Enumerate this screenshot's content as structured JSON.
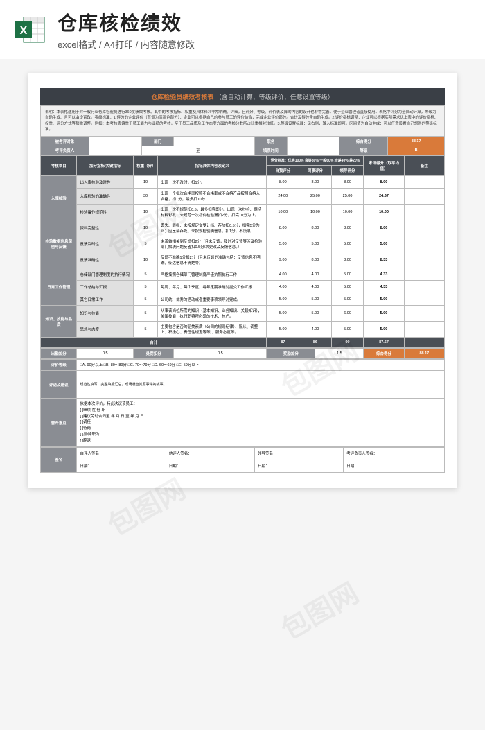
{
  "header": {
    "main_title": "仓库核检绩效",
    "sub_title": "excel格式 / A4打印 / 内容随意修改",
    "icon_label": "X"
  },
  "doc": {
    "title_main": "仓库检验员绩效考核表",
    "title_sub": "（含自动计算、等级评价、任意设置等级）",
    "instructions": "说明：本表格适用于对一般行业仓库检验员进行360度绩效考核。其中的考核指标、权重及具体释义非常明确、详细。且评分、等级、评价表及算的内容的设计也非常完善。便于企业管理者直接使用。表格中评分为全自动计算，等级为自动生成、且可以由设置改。零级标准：1.评分的企业评价（背景为深灰色部分）：企业可以根据自己的参与员工的评价结合，完成企业评价部分。合计及得分全自动生成。2.评价指标调整：企业可以根据实际需求优上表中的评价指标、权重、评分方式等稍微调整。例如：本考核表偏重于员工能力与业绩的考核，至于员工品质及工作态度方面的考核分数所占比重相对较低。3.等级设置标准：见右侧，输入标准即可。区间值为自动生成；可以任意设置自己想得的等级标准。"
  },
  "info": {
    "subject_label": "被考评对象",
    "dept_label": "部门",
    "position_label": "职务",
    "total_score_label": "综合得分",
    "total_score": "88.17",
    "leader_label": "考评负责人",
    "to_label": "至",
    "period_label": "填表时间",
    "grade_label": "等级",
    "grade": "B"
  },
  "table_head": {
    "c1": "考核项目",
    "c2": "加分指标/关键指标",
    "c3": "权重（分）",
    "c4": "指标具体内容及定义",
    "c5a": "评分标准：优秀100%   良好80%   一般60%    较差40%   差20%",
    "c5b1": "自我评分",
    "c5b2": "同事评分",
    "c5b3": "领导评分",
    "c6": "考评得分（取平均值）",
    "c7": "备注"
  },
  "chart_data": {
    "type": "table",
    "title": "仓库检验员绩效考核表",
    "sections": [
      {
        "name": "入库核验",
        "rows": [
          {
            "indicator": "出入库检验及时性",
            "weight": 10,
            "desc": "出现一次不及时，扣1分。",
            "self": 8.0,
            "peer": 8.0,
            "lead": 8.0,
            "score": 8.0
          },
          {
            "indicator": "入库检验的准确性",
            "weight": 30,
            "desc": "出现一个批次合格率按照不合格率或不合格产品按照合格入合格，扣1分，最多扣10分",
            "self": 24.0,
            "peer": 25.0,
            "lead": 25.0,
            "score": 24.67
          },
          {
            "indicator": "检验操作规范性",
            "weight": 10,
            "desc": "出现一次不规范扣0.5，最多扣完即分。出现一次抄检、保持材料彩孔、未规范一次初价检验漏扣2分，扣完10分为止。",
            "self": 10.0,
            "peer": 10.0,
            "lead": 10.0,
            "score": 10.0
          }
        ]
      },
      {
        "name": "检验数据信息保密与反馈",
        "rows": [
          {
            "indicator": "资料完整性",
            "weight": 10,
            "desc": "丢失、毁损、未按规定交受计档、存放扣0.5分，扣完5分为止；应呈会存处、未按规检验确信息，扣1分，不设限",
            "self": 8.0,
            "peer": 8.0,
            "lead": 8.0,
            "score": 8.0
          },
          {
            "indicator": "反馈及时性",
            "weight": 5,
            "desc": "未该做相关到反馈扣2分（且未反馈，及时对反馈等涉及检验部门解决问题反省扣0.5分/次更改及反馈信息。）",
            "self": 5.0,
            "peer": 5.0,
            "lead": 5.0,
            "score": 5.0
          },
          {
            "indicator": "反馈准确性",
            "weight": 10,
            "desc": "反馈不准确1分扣2分（且未反馈的准确包括：反馈信息不明确，传达信息不清楚等）",
            "self": 9.0,
            "peer": 8.0,
            "lead": 8.0,
            "score": 8.33
          }
        ]
      },
      {
        "name": "日常工作管理",
        "rows": [
          {
            "indicator": "仓储部门管理制度的执行情况",
            "weight": 5,
            "desc": "严格按照仓储部门管理制度严谨执照执行工作",
            "self": 4.0,
            "peer": 4.0,
            "lead": 5.0,
            "score": 4.33
          },
          {
            "indicator": "工作总结与汇报",
            "weight": 5,
            "desc": "每周、每月、每个季度，每年定期准确对提交工作汇报",
            "self": 4.0,
            "peer": 4.0,
            "lead": 5.0,
            "score": 4.33
          },
          {
            "indicator": "其它日常工作",
            "weight": 5,
            "desc": "公司统一优秀的活动或者重要事项领导对完成。",
            "self": 5.0,
            "peer": 5.0,
            "lead": 5.0,
            "score": 5.0
          }
        ]
      },
      {
        "name": "知识、技能与品质",
        "rows": [
          {
            "indicator": "知识与技能",
            "weight": 5,
            "desc": "从事该岗位所需的知识（基本知识、业务知识、关联知识），美属技能；执行职特所必须的技术、技巧。",
            "self": 5.0,
            "peer": 5.0,
            "lead": 6.0,
            "score": 5.0
          },
          {
            "indicator": "思想与态度",
            "weight": 5,
            "desc": "主要包含是否的韶美素质（公司的规则纪律）、服从、调整上、积极心、责任性规定等等)、服务态度等。",
            "self": 5.0,
            "peer": 4.0,
            "lead": 5.0,
            "score": 5.0
          }
        ]
      }
    ],
    "totals": {
      "label": "合计",
      "self": 87.0,
      "peer": 86.0,
      "lead": 90.0,
      "score": 87.67
    }
  },
  "bonus": {
    "add_label": "出勤加分",
    "add_val": "0.5",
    "penalty_label": "处罚扣分",
    "penalty_val": "0.5",
    "reward_label": "奖励加分",
    "reward_val": "1.5",
    "final_label": "综合得分",
    "final_val": "88.17"
  },
  "grade_row": {
    "label": "评价等级",
    "options": "□A. 90分以上   □B. 80～89分   □C. 70～79分   □D. 60～69分   □E. 59分以下"
  },
  "comments": {
    "label": "评语及建议",
    "text": ""
  },
  "opinion": {
    "label": "晋升意见",
    "line1": "依据本次评价，特此决议该员工：",
    "opt1": "[ ]继续       在     任     职",
    "opt2": "[ ]建议劳动合同至     年     月     日     至     年     月     日",
    "opt3": "[ ]调任",
    "opt4": "[ ]待岗",
    "opt5": "[ ]加/降职为",
    "opt6": "[ ]辞退"
  },
  "sign": {
    "label": "签名",
    "s1": "自评人签名：",
    "s2": "他评人签名：",
    "s3": "领导签名：",
    "s4": "考评负责人签名：",
    "d": "日期：",
    "d2": "日期：",
    "d3": "日期：",
    "d4": "日期："
  }
}
